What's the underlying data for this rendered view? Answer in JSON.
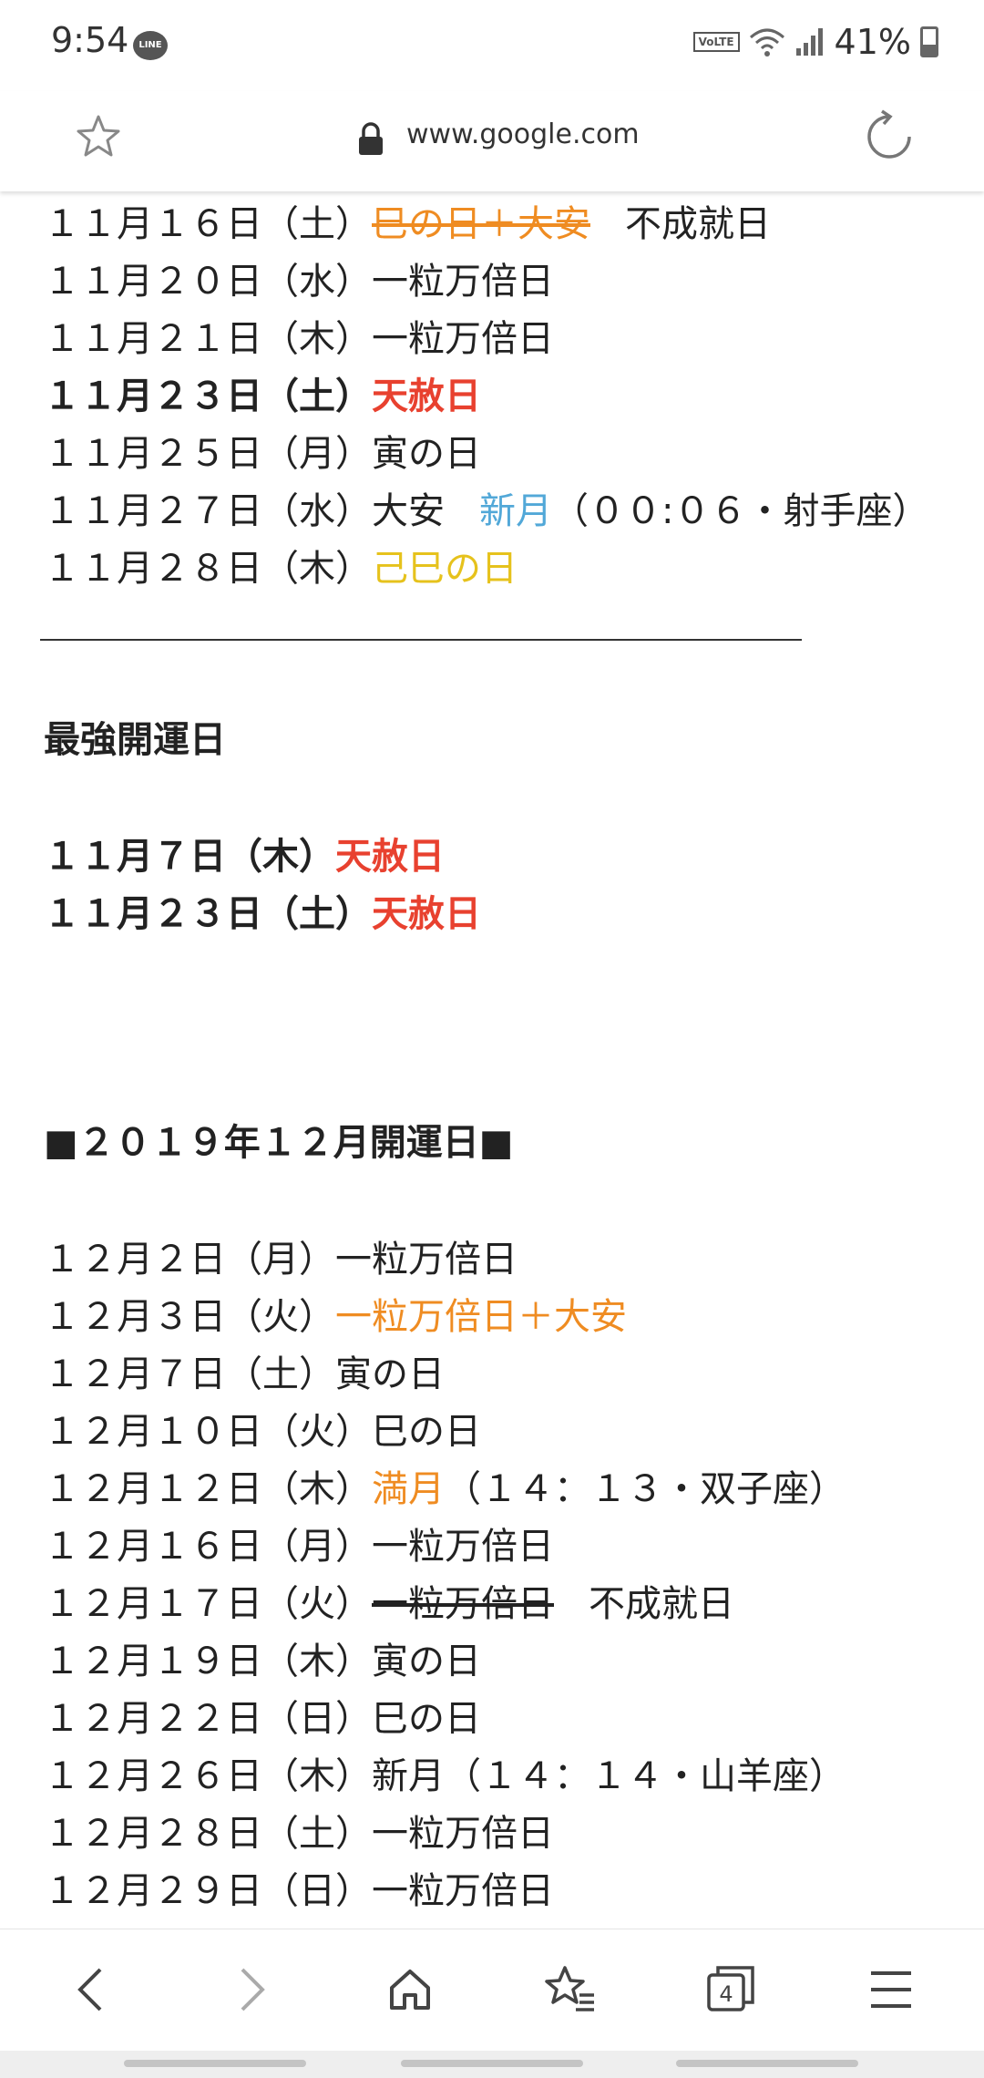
{
  "status": {
    "time": "9:54",
    "line_label": "LINE",
    "volte": "VoLTE",
    "battery": "41%"
  },
  "browser": {
    "url": "www.google.com",
    "tab_count": "4"
  },
  "nov": [
    {
      "date": "１１月１６日（土）",
      "parts": [
        {
          "text": "巳の日＋大安",
          "cls": "orange strike"
        },
        {
          "text": "",
          "cls": "gap"
        },
        {
          "text": "不成就日",
          "cls": ""
        }
      ]
    },
    {
      "date": "１１月２０日（水）",
      "parts": [
        {
          "text": "一粒万倍日",
          "cls": ""
        }
      ]
    },
    {
      "date": "１１月２１日（木）",
      "parts": [
        {
          "text": "一粒万倍日",
          "cls": ""
        }
      ]
    },
    {
      "date": "１１月２３日（土）",
      "bold": true,
      "parts": [
        {
          "text": "天赦日",
          "cls": "red"
        }
      ]
    },
    {
      "date": "１１月２５日（月）",
      "parts": [
        {
          "text": "寅の日",
          "cls": ""
        }
      ]
    },
    {
      "date": "１１月２７日（水）",
      "parts": [
        {
          "text": "大安",
          "cls": ""
        },
        {
          "text": "",
          "cls": "gap"
        },
        {
          "text": "新月",
          "cls": "blue"
        },
        {
          "text": "（００:０６・射手座）",
          "cls": ""
        }
      ]
    },
    {
      "date": "１１月２８日（木）",
      "parts": [
        {
          "text": "己巳の日",
          "cls": "gold"
        }
      ]
    }
  ],
  "best_heading": "最強開運日",
  "best": [
    {
      "date": "１１月７日（木）",
      "bold": true,
      "parts": [
        {
          "text": "天赦日",
          "cls": "red"
        }
      ]
    },
    {
      "date": "１１月２３日（土）",
      "bold": true,
      "parts": [
        {
          "text": "天赦日",
          "cls": "red"
        }
      ]
    }
  ],
  "dec_heading": "■２０１９年１２月開運日■",
  "dec": [
    {
      "date": "１２月２日（月）",
      "parts": [
        {
          "text": "一粒万倍日",
          "cls": ""
        }
      ]
    },
    {
      "date": "１２月３日（火）",
      "parts": [
        {
          "text": "一粒万倍日＋大安",
          "cls": "orange"
        }
      ]
    },
    {
      "date": "１２月７日（土）",
      "parts": [
        {
          "text": "寅の日",
          "cls": ""
        }
      ]
    },
    {
      "date": "１２月１０日（火）",
      "parts": [
        {
          "text": "巳の日",
          "cls": ""
        }
      ]
    },
    {
      "date": "１２月１２日（木）",
      "parts": [
        {
          "text": "満月",
          "cls": "orange"
        },
        {
          "text": "（１４：１３・双子座）",
          "cls": ""
        }
      ]
    },
    {
      "date": "１２月１６日（月）",
      "parts": [
        {
          "text": "一粒万倍日",
          "cls": ""
        }
      ]
    },
    {
      "date": "１２月１７日（火）",
      "parts": [
        {
          "text": "一粒万倍日",
          "cls": "strike"
        },
        {
          "text": "",
          "cls": "gap"
        },
        {
          "text": "不成就日",
          "cls": ""
        }
      ]
    },
    {
      "date": "１２月１９日（木）",
      "parts": [
        {
          "text": "寅の日",
          "cls": ""
        }
      ]
    },
    {
      "date": "１２月２２日（日）",
      "parts": [
        {
          "text": "巳の日",
          "cls": ""
        }
      ]
    },
    {
      "date": "１２月２６日（木）",
      "parts": [
        {
          "text": "新月（１４：１４・山羊座）",
          "cls": ""
        }
      ]
    },
    {
      "date": "１２月２８日（土）",
      "parts": [
        {
          "text": "一粒万倍日",
          "cls": ""
        }
      ]
    },
    {
      "date": "１２月２９日（日）",
      "parts": [
        {
          "text": "一粒万倍日",
          "cls": ""
        }
      ]
    }
  ]
}
